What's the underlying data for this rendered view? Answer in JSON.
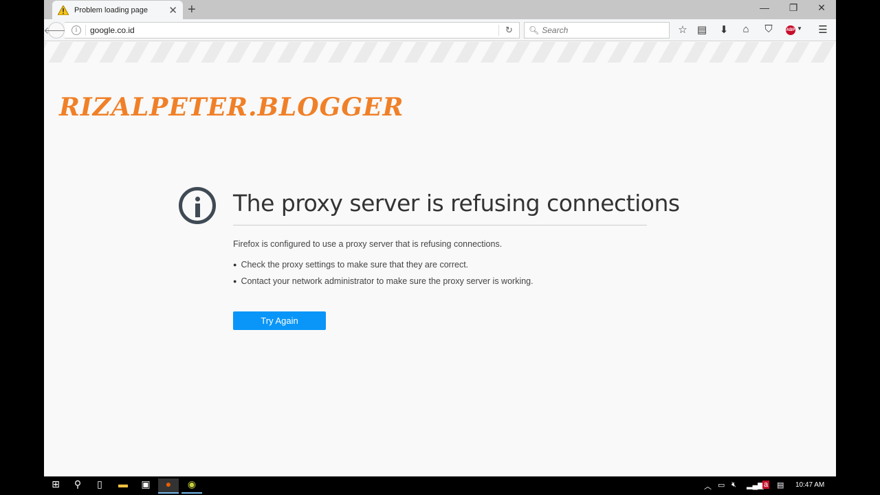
{
  "browser": {
    "tab": {
      "title": "Problem loading page",
      "icon": "warning-icon"
    },
    "new_tab_label": "+",
    "window_controls": {
      "minimize": "—",
      "restore": "❐",
      "close": "✕"
    },
    "url": "google.co.id",
    "search_placeholder": "Search",
    "toolbar_icons": [
      "bookmark-star-icon",
      "reading-list-icon",
      "downloads-icon",
      "home-icon",
      "pocket-icon",
      "adblock-plus-icon",
      "menu-icon"
    ],
    "abp_label": "ABP"
  },
  "watermark": "RIZALPETER.BLOGGER",
  "error": {
    "title": "The proxy server is refusing connections",
    "description": "Firefox is configured to use a proxy server that is refusing connections.",
    "suggestions": [
      "Check the proxy settings to make sure that they are correct.",
      "Contact your network administrator to make sure the proxy server is working."
    ],
    "try_again_label": "Try Again"
  },
  "taskbar": {
    "items": [
      "start-icon",
      "search-icon",
      "task-view-icon",
      "file-explorer-icon",
      "store-icon",
      "firefox-icon",
      "app-icon"
    ],
    "clock": "10:47 AM"
  },
  "colors": {
    "accent": "#0996f8",
    "watermark": "#f08028",
    "icon": "#3f4a54"
  }
}
